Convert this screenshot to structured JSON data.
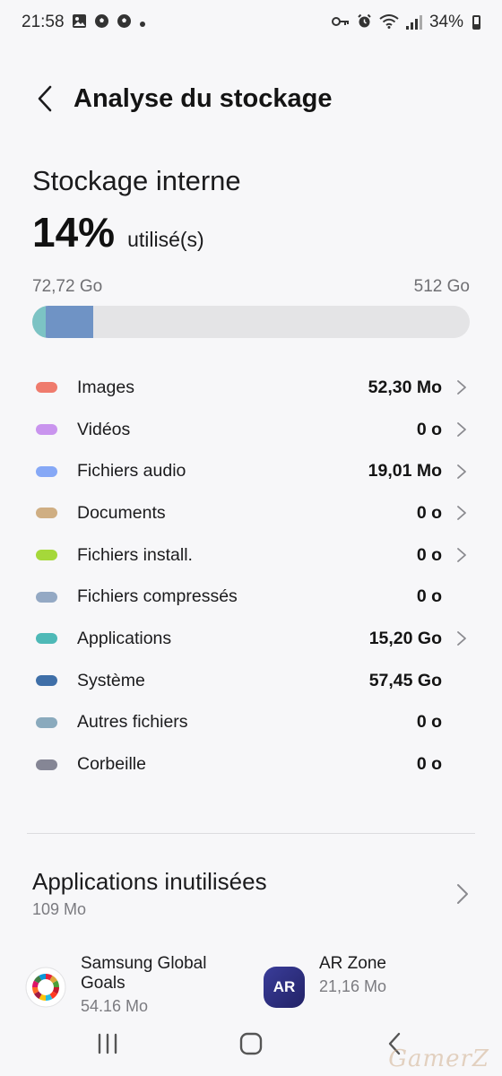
{
  "status_bar": {
    "time": "21:58",
    "battery": "34%",
    "left_icons": [
      "gallery-icon",
      "soccer-icon",
      "soccer-icon",
      "dot-icon"
    ],
    "right_icons": [
      "key-icon",
      "alarm-icon",
      "wifi-icon",
      "signal-icon",
      "battery-icon"
    ]
  },
  "header": {
    "title": "Analyse du stockage"
  },
  "storage": {
    "title": "Stockage interne",
    "percent": "14%",
    "percent_label": "utilisé(s)",
    "used_label": "72,72 Go",
    "total_label": "512 Go",
    "used_fraction": 0.14,
    "segments": [
      {
        "name": "Applications",
        "color": "#7cc3c4",
        "fraction": 0.03
      },
      {
        "name": "Système",
        "color": "#6f93c5",
        "fraction": 0.11
      }
    ]
  },
  "categories": [
    {
      "label": "Images",
      "value": "52,30 Mo",
      "color": "#ef7b6d",
      "chevron": true
    },
    {
      "label": "Vidéos",
      "value": "0 o",
      "color": "#c994ee",
      "chevron": true
    },
    {
      "label": "Fichiers audio",
      "value": "19,01 Mo",
      "color": "#86a8f6",
      "chevron": true
    },
    {
      "label": "Documents",
      "value": "0 o",
      "color": "#cfae83",
      "chevron": true
    },
    {
      "label": "Fichiers install.",
      "value": "0 o",
      "color": "#a5d83a",
      "chevron": true
    },
    {
      "label": "Fichiers compressés",
      "value": "0 o",
      "color": "#94a9c4",
      "chevron": false
    },
    {
      "label": "Applications",
      "value": "15,20 Go",
      "color": "#4eb9b7",
      "chevron": true
    },
    {
      "label": "Système",
      "value": "57,45 Go",
      "color": "#3f6fa8",
      "chevron": false
    },
    {
      "label": "Autres fichiers",
      "value": "0 o",
      "color": "#8aaabd",
      "chevron": false
    },
    {
      "label": "Corbeille",
      "value": "0 o",
      "color": "#858695",
      "chevron": false
    }
  ],
  "unused_apps": {
    "title": "Applications inutilisées",
    "size": "109 Mo",
    "apps": [
      {
        "name": "Samsung Global Goals",
        "size": "54,16 Mo",
        "icon": "global-goals-icon"
      },
      {
        "name": "AR Zone",
        "size": "21,16 Mo",
        "icon": "ar-zone-icon",
        "icon_text": "AR"
      }
    ]
  },
  "watermark": "GamerZ"
}
